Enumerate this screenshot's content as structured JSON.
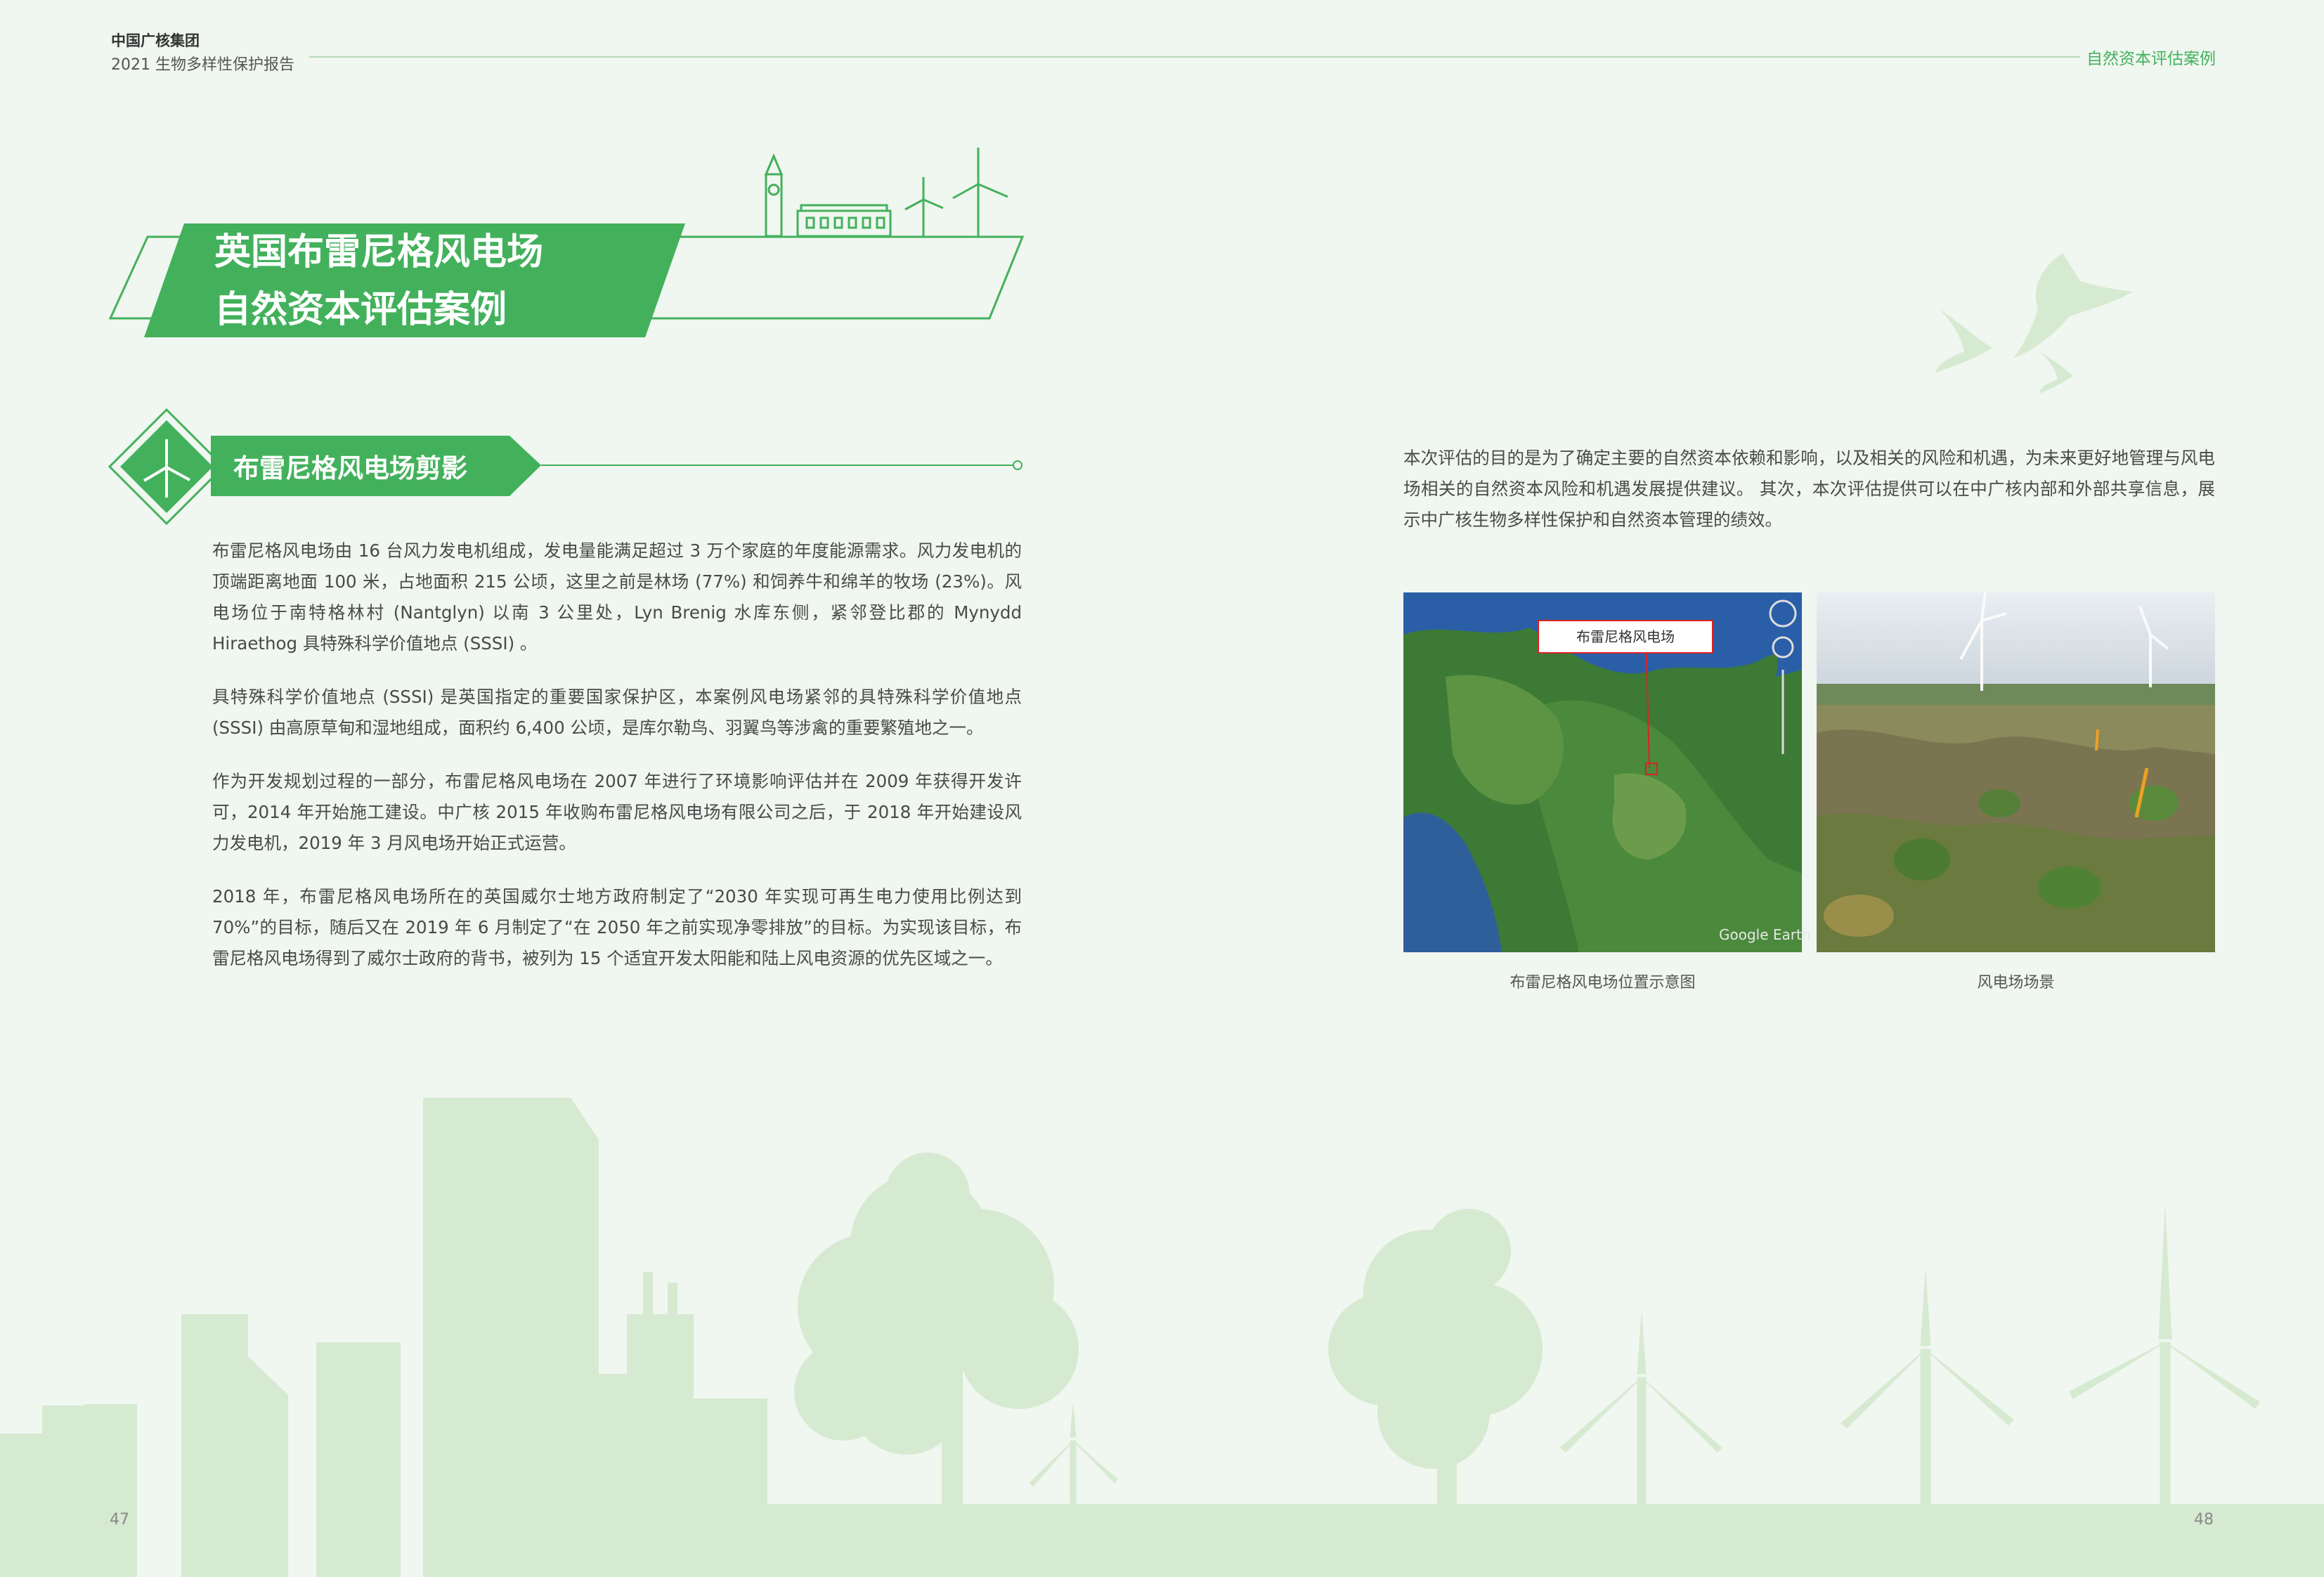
{
  "header": {
    "org": "中国广核集团",
    "report": "2021 生物多样性保护报告",
    "section": "自然资本评估案例"
  },
  "title": {
    "line1": "英国布雷尼格风电场",
    "line2": "自然资本评估案例"
  },
  "subheading": "布雷尼格风电场剪影",
  "body": [
    "布雷尼格风电场由 16 台风力发电机组成，发电量能满足超过 3 万个家庭的年度能源需求。风力发电机的顶端距离地面 100 米，占地面积 215 公顷，这里之前是林场 (77%) 和饲养牛和绵羊的牧场 (23%)。风电场位于南特格林村 (Nantglyn) 以南 3 公里处，Lyn Brenig 水库东侧，紧邻登比郡的 Mynydd Hiraethog 具特殊科学价值地点 (SSSI) 。",
    "具特殊科学价值地点 (SSSI) 是英国指定的重要国家保护区，本案例风电场紧邻的具特殊科学价值地点 (SSSI) 由高原草甸和湿地组成，面积约 6,400 公顷，是库尔勒鸟、羽翼鸟等涉禽的重要繁殖地之一。",
    "作为开发规划过程的一部分，布雷尼格风电场在 2007 年进行了环境影响评估并在 2009 年获得开发许可，2014 年开始施工建设。中广核 2015 年收购布雷尼格风电场有限公司之后，于 2018 年开始建设风力发电机，2019 年 3 月风电场开始正式运营。",
    "2018 年，布雷尼格风电场所在的英国威尔士地方政府制定了“2030 年实现可再生电力使用比例达到 70%”的目标，随后又在 2019 年 6 月制定了“在 2050 年之前实现净零排放”的目标。为实现该目标，布雷尼格风电场得到了威尔士政府的背书，被列为 15 个适宜开发太阳能和陆上风电资源的优先区域之一。"
  ],
  "intro": "本次评估的目的是为了确定主要的自然资本依赖和影响，以及相关的风险和机遇，为未来更好地管理与风电场相关的自然资本风险和机遇发展提供建议。 其次，本次评估提供可以在中广核内部和外部共享信息，展示中广核生物多样性保护和自然资本管理的绩效。",
  "map": {
    "label": "布雷尼格风电场",
    "watermark": "Google Earth",
    "caption": "布雷尼格风电场位置示意图"
  },
  "scene_caption": "风电场场景",
  "pages": {
    "left": "47",
    "right": "48"
  },
  "colors": {
    "green": "#43b15c",
    "light_green": "#d5e8d0",
    "background": "#f0f6f0"
  }
}
